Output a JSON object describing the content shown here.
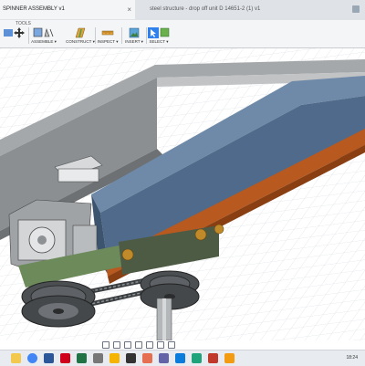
{
  "tabs": {
    "active": "SPINNER ASSEMBLY  v1",
    "inactive": "steel structure - drop off unit D 14651-2 (1) v1",
    "close": "×"
  },
  "toolbar": {
    "tools_label": "TOOLS",
    "assemble": "ASSEMBLE ▾",
    "construct": "CONSTRUCT ▾",
    "inspect": "INSPECT ▾",
    "insert": "INSERT ▾",
    "select": "SELECT ▾"
  },
  "navbar": {
    "icons": [
      "orbit-icon",
      "pan-icon",
      "zoom-icon",
      "fit-icon",
      "display-icon",
      "grid-icon",
      "viewports-icon"
    ]
  },
  "taskbar": {
    "icons": [
      "file-explorer-icon",
      "chrome-icon",
      "word-icon",
      "autodesk-icon",
      "excel-icon",
      "settings-icon",
      "notes-icon",
      "terminal-icon",
      "sketch-icon",
      "teams-icon",
      "photos-icon",
      "game-icon",
      "media-icon",
      "fusion-icon"
    ],
    "time": "18:24"
  },
  "colors": {
    "accent": "#2f80ed",
    "beam_gray": "#8b8f92",
    "beam_blue": "#4f6a8a",
    "orange": "#b8591f",
    "gear": "#4b4f52"
  }
}
